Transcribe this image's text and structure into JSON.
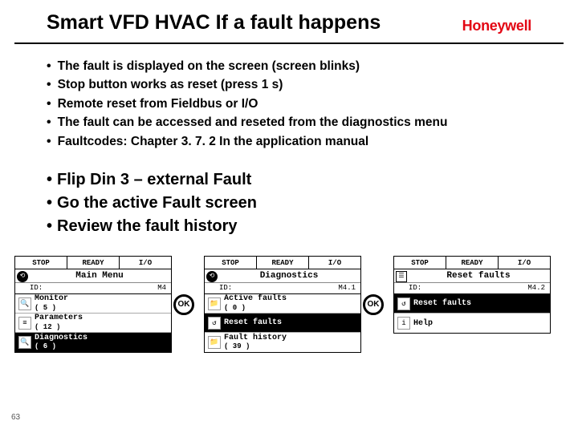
{
  "header": {
    "title": "Smart VFD HVAC If a fault happens",
    "brand": "Honeywell"
  },
  "bullets": {
    "b0": "The fault is displayed on the screen (screen blinks)",
    "b1": "Stop button works as reset (press 1 s)",
    "b2": "Remote reset from Fieldbus or I/O",
    "b3": "The fault can be accessed and reseted from the diagnostics menu",
    "b4": "Faultcodes: Chapter 3. 7. 2 In the application manual"
  },
  "actions": {
    "a0": "Flip Din 3 – external Fault",
    "a1": "Go the active Fault screen",
    "a2": "Review the fault history"
  },
  "status": {
    "stop": "STOP",
    "ready": "READY",
    "io": "I/O"
  },
  "panel1": {
    "title": "Main Menu",
    "id_label": "ID:",
    "id_val": "M4",
    "m0l": "Monitor",
    "m0c": "( 5 )",
    "m1l": "Parameters",
    "m1c": "( 12 )",
    "m2l": "Diagnostics",
    "m2c": "( 6 )"
  },
  "panel2": {
    "title": "Diagnostics",
    "id_label": "ID:",
    "id_val": "M4.1",
    "m0l": "Active faults",
    "m0c": "( 0 )",
    "m1l": "Reset faults",
    "m2l": "Fault history",
    "m2c": "( 39 )"
  },
  "panel3": {
    "title": "Reset faults",
    "id_label": "ID:",
    "id_val": "M4.2",
    "m0l": "Reset faults",
    "m1l": "Help"
  },
  "ok": "OK",
  "page": "63"
}
